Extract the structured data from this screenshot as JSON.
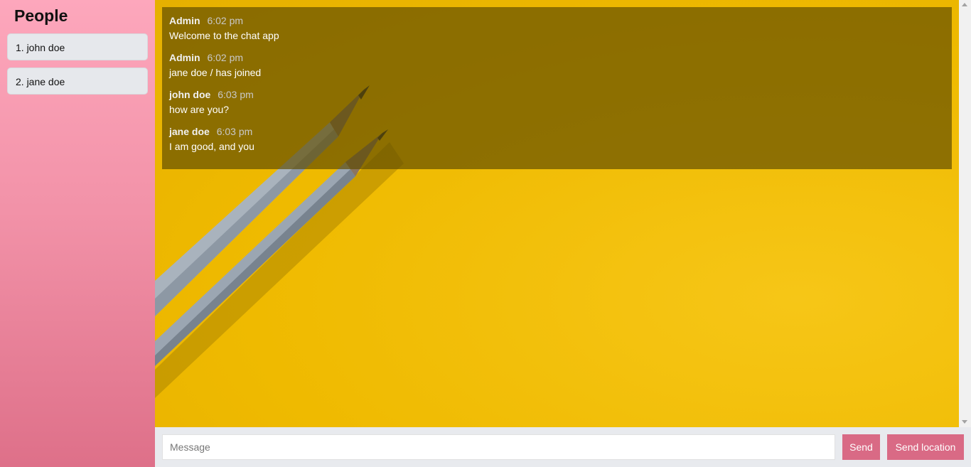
{
  "sidebar": {
    "title": "People",
    "people": [
      {
        "label": "1. john doe"
      },
      {
        "label": "2. jane doe"
      }
    ]
  },
  "messages": [
    {
      "name": "Admin",
      "time": "6:02 pm",
      "text": "Welcome to the chat app"
    },
    {
      "name": "Admin",
      "time": "6:02 pm",
      "text": "jane doe / has joined"
    },
    {
      "name": "john doe",
      "time": "6:03 pm",
      "text": "how are you?"
    },
    {
      "name": "jane doe",
      "time": "6:03 pm",
      "text": "I am good, and you"
    }
  ],
  "composer": {
    "placeholder": "Message",
    "value": "",
    "send_label": "Send",
    "location_label": "Send location"
  },
  "colors": {
    "sidebar_top": "#fda7bc",
    "sidebar_bottom": "#de7089",
    "button": "#d96a85",
    "background_yellow": "#efba00"
  }
}
